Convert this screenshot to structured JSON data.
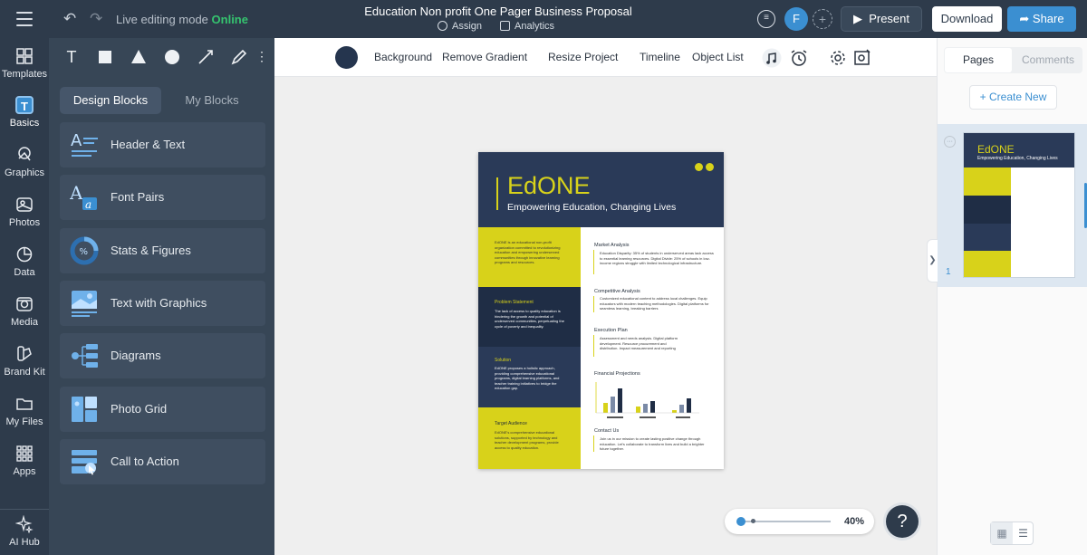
{
  "header": {
    "mode_label": "Live editing mode",
    "mode_status": "Online",
    "title": "Education Non profit One Pager Business Proposal",
    "assign": "Assign",
    "analytics": "Analytics",
    "avatar": "F",
    "present": "Present",
    "download": "Download",
    "share": "Share",
    "accent": "#3b8fd1",
    "online_color": "#35c46f"
  },
  "nav": {
    "items": [
      {
        "label": "Templates",
        "icon": "templates-icon"
      },
      {
        "label": "Basics",
        "icon": "basics-icon"
      },
      {
        "label": "Graphics",
        "icon": "graphics-icon"
      },
      {
        "label": "Photos",
        "icon": "photos-icon"
      },
      {
        "label": "Data",
        "icon": "data-icon"
      },
      {
        "label": "Media",
        "icon": "media-icon"
      },
      {
        "label": "Brand Kit",
        "icon": "brand-kit-icon"
      },
      {
        "label": "My Files",
        "icon": "folder-icon"
      },
      {
        "label": "Apps",
        "icon": "apps-icon"
      },
      {
        "label": "AI Hub",
        "icon": "sparkle-icon"
      }
    ],
    "basics_glyph": "T"
  },
  "panel": {
    "text_tool": "T",
    "tabs": {
      "design": "Design Blocks",
      "my": "My Blocks"
    },
    "blocks": [
      {
        "label": "Header & Text"
      },
      {
        "label": "Font Pairs"
      },
      {
        "label": "Stats & Figures"
      },
      {
        "label": "Text with Graphics"
      },
      {
        "label": "Diagrams"
      },
      {
        "label": "Photo Grid"
      },
      {
        "label": "Call to Action"
      }
    ],
    "font_pairs_glyph": "A",
    "font_pairs_glyph2": "a",
    "header_glyph": "A",
    "stats_glyph": "%"
  },
  "toolbar": {
    "background": "Background",
    "remove_gradient": "Remove Gradient",
    "resize": "Resize Project",
    "timeline": "Timeline",
    "object_list": "Object List",
    "color": "#25354e"
  },
  "doc": {
    "title": "EdONE",
    "subtitle": "Empowering Education, Changing Lives",
    "brand_yellow": "#d8d21a",
    "brand_navy": "#2a3a58",
    "intro": "EdONE is an educational non-profit organization committed to revolutionizing education and empowering underserved communities through innovative learning programs and resources.",
    "problem_h": "Problem Statement",
    "problem_t": "The lack of access to quality education is hindering the growth and potential of underserved communities, perpetuating the cycle of poverty and inequality.",
    "solution_h": "Solution",
    "solution_t": "EdONE proposes a holistic approach, providing comprehensive educational programs, digital learning platforms, and teacher training initiatives to bridge the education gap.",
    "target_h": "Target Audience",
    "target_t": "EdONE's comprehensive educational solutions, supported by technology and teacher development programs, provide access to quality education.",
    "market_h": "Market Analysis",
    "market_t": "Education Disparity: 35% of students in underserved areas lack access to essential learning resources. Digital Divide: 25% of schools in low-income regions struggle with limited technological infrastructure.",
    "comp_h": "Competitive Analysis",
    "comp_t": "Customized educational content to address local challenges. Equip educators with modern teaching methodologies. Digital platforms for seamless learning, breaking barriers",
    "exec_h": "Execution Plan",
    "exec_t": "Assessment and needs analysis. Digital platform development. Resource procurement and distribution. Impact measurement and reporting",
    "fin_h": "Financial Projections",
    "contact_h": "Contact Us",
    "contact_t": "Join us in our mission to create lasting positive change through education. Let's collaborate to transform lives and build a brighter future together."
  },
  "zoom": {
    "value": "40%",
    "level": 0.05
  },
  "help": "?",
  "right": {
    "pages": "Pages",
    "comments": "Comments",
    "create_new": "Create New",
    "page_number": "1",
    "thumb_title": "EdONE",
    "thumb_sub": "Empowering Education, Changing Lives"
  }
}
